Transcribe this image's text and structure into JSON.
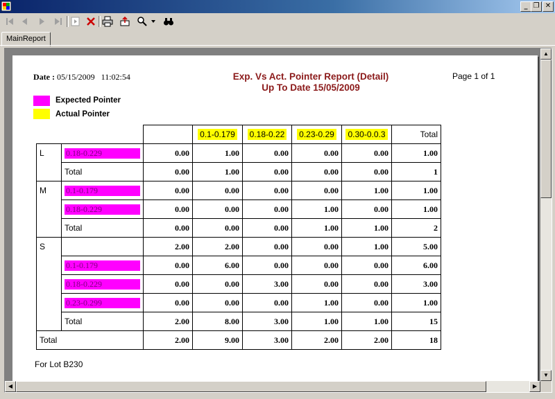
{
  "window": {
    "title": "",
    "buttons": [
      "_",
      "❐",
      "✕"
    ]
  },
  "toolbar": {
    "icons": [
      "first-page-icon",
      "previous-page-icon",
      "next-page-icon",
      "last-page-icon",
      "goto-page-icon",
      "stop-icon",
      "print-icon",
      "export-icon",
      "zoom-icon",
      "search-icon"
    ]
  },
  "tabs": [
    {
      "label": "MainReport"
    }
  ],
  "report": {
    "date_label": "Date :",
    "date_value": "05/15/2009",
    "time_value": "11:02:54",
    "title_line1": "Exp. Vs Act. Pointer Report (Detail)",
    "title_line2": "Up To Date 15/05/2009",
    "page_info": "Page 1 of 1",
    "legend": [
      {
        "label": "Expected Pointer",
        "color": "#ff00ff"
      },
      {
        "label": "Actual Pointer",
        "color": "#ffff00"
      }
    ],
    "columns": [
      "0.1-0.179",
      "0.18-0.22",
      "0.23-0.29",
      "0.30-0.0.3"
    ],
    "total_label": "Total",
    "groups": [
      {
        "name": "L",
        "rows": [
          {
            "label": "0.18-0.229",
            "values": [
              "0.00",
              "1.00",
              "0.00",
              "0.00",
              "0.00",
              "1.00"
            ]
          },
          {
            "label": "Total",
            "values": [
              "0.00",
              "1.00",
              "0.00",
              "0.00",
              "0.00",
              "1"
            ]
          }
        ]
      },
      {
        "name": "M",
        "rows": [
          {
            "label": "0.1-0.179",
            "values": [
              "0.00",
              "0.00",
              "0.00",
              "0.00",
              "1.00",
              "1.00"
            ]
          },
          {
            "label": "0.18-0.229",
            "values": [
              "0.00",
              "0.00",
              "0.00",
              "1.00",
              "0.00",
              "1.00"
            ]
          },
          {
            "label": "Total",
            "values": [
              "0.00",
              "0.00",
              "0.00",
              "1.00",
              "1.00",
              "2"
            ]
          }
        ]
      },
      {
        "name": "S",
        "rows": [
          {
            "label": "",
            "values": [
              "2.00",
              "2.00",
              "0.00",
              "0.00",
              "1.00",
              "5.00"
            ]
          },
          {
            "label": "0.1-0.179",
            "values": [
              "0.00",
              "6.00",
              "0.00",
              "0.00",
              "0.00",
              "6.00"
            ]
          },
          {
            "label": "0.18-0.229",
            "values": [
              "0.00",
              "0.00",
              "3.00",
              "0.00",
              "0.00",
              "3.00"
            ]
          },
          {
            "label": "0.23-0.299",
            "values": [
              "0.00",
              "0.00",
              "0.00",
              "1.00",
              "0.00",
              "1.00"
            ]
          },
          {
            "label": "Total",
            "values": [
              "2.00",
              "8.00",
              "3.00",
              "1.00",
              "1.00",
              "15"
            ]
          }
        ]
      }
    ],
    "grand_total": {
      "label": "Total",
      "values": [
        "2.00",
        "9.00",
        "3.00",
        "2.00",
        "2.00",
        "18"
      ]
    },
    "footer": "For Lot B230"
  }
}
